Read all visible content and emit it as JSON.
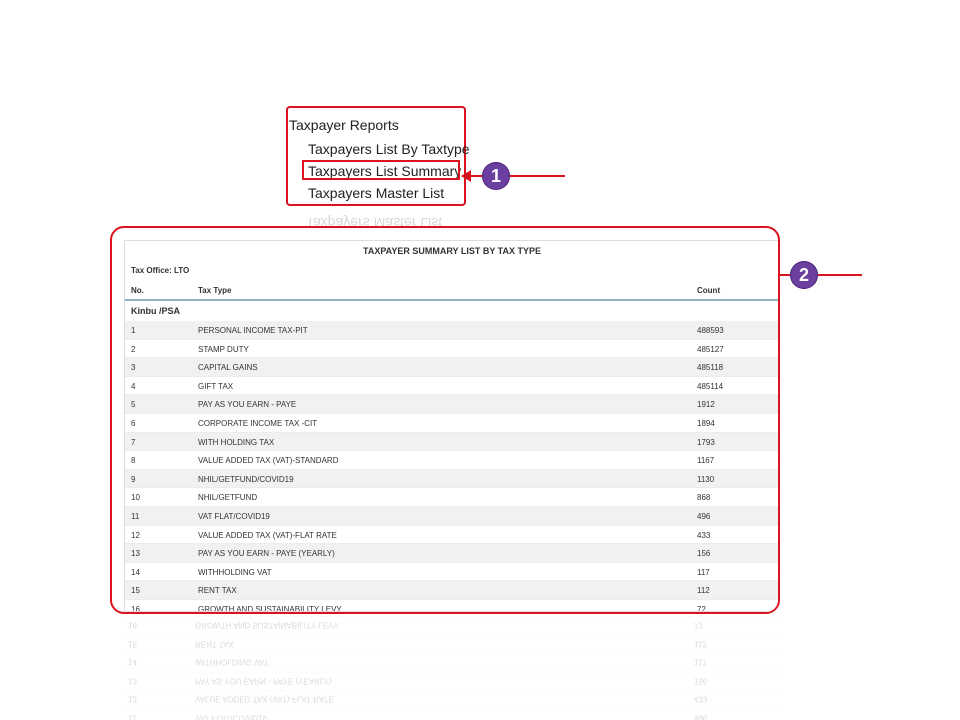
{
  "menu": {
    "title": "Taxpayer Reports",
    "items": [
      {
        "label": "Taxpayers List By Taxtype"
      },
      {
        "label": "Taxpayers List Summary"
      },
      {
        "label": "Taxpayers Master List"
      }
    ]
  },
  "callouts": {
    "badge1": "1",
    "badge2": "2"
  },
  "report": {
    "title": "TAXPAYER SUMMARY LIST BY TAX TYPE",
    "tax_office": "Tax Office: LTO",
    "columns": {
      "no": "No.",
      "tax_type": "Tax Type",
      "count": "Count"
    },
    "group": "Kinbu /PSA",
    "rows": [
      {
        "no": "1",
        "tax_type": "PERSONAL INCOME TAX-PIT",
        "count": "488593"
      },
      {
        "no": "2",
        "tax_type": "STAMP DUTY",
        "count": "485127"
      },
      {
        "no": "3",
        "tax_type": "CAPITAL GAINS",
        "count": "485118"
      },
      {
        "no": "4",
        "tax_type": "GIFT TAX",
        "count": "485114"
      },
      {
        "no": "5",
        "tax_type": "PAY AS YOU EARN - PAYE",
        "count": "1912"
      },
      {
        "no": "6",
        "tax_type": "CORPORATE INCOME TAX -CIT",
        "count": "1894"
      },
      {
        "no": "7",
        "tax_type": "WITH HOLDING TAX",
        "count": "1793"
      },
      {
        "no": "8",
        "tax_type": "VALUE ADDED TAX (VAT)-STANDARD",
        "count": "1167"
      },
      {
        "no": "9",
        "tax_type": "NHIL/GETFUND/COVID19",
        "count": "1130"
      },
      {
        "no": "10",
        "tax_type": "NHIL/GETFUND",
        "count": "868"
      },
      {
        "no": "11",
        "tax_type": "VAT FLAT/COVID19",
        "count": "496"
      },
      {
        "no": "12",
        "tax_type": "VALUE ADDED TAX (VAT)-FLAT RATE",
        "count": "433"
      },
      {
        "no": "13",
        "tax_type": "PAY AS YOU EARN - PAYE (YEARLY)",
        "count": "156"
      },
      {
        "no": "14",
        "tax_type": "WITHHOLDING VAT",
        "count": "117"
      },
      {
        "no": "15",
        "tax_type": "RENT TAX",
        "count": "112"
      },
      {
        "no": "16",
        "tax_type": "GROWTH AND SUSTAINABILITY LEVY",
        "count": "72"
      }
    ]
  },
  "colors": {
    "callout_border": "#d9141c",
    "badge": "#6b3fa0",
    "header_rule": "#8fb3c0"
  }
}
